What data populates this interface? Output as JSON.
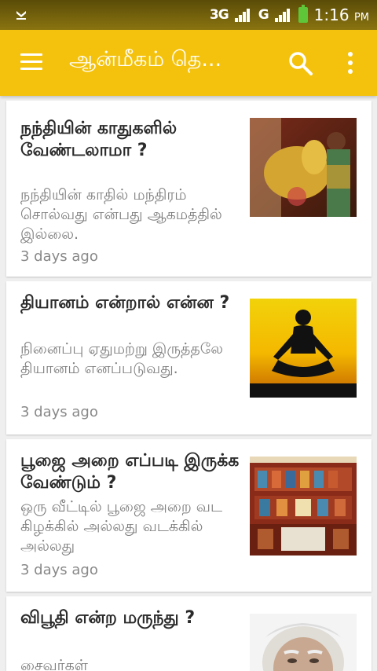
{
  "status_bar": {
    "network_label": "3G",
    "sim2_label": "G",
    "time": "1:16",
    "ampm": "PM"
  },
  "app_bar": {
    "title": "ஆன்மீகம் தெ...",
    "menu_icon": "hamburger-menu-icon",
    "search_icon": "search-icon",
    "overflow_icon": "more-vertical-icon"
  },
  "articles": [
    {
      "title": "நந்தியின் காதுகளில் வேண்டலாமா ?",
      "excerpt": "நந்தியின் காதில் மந்திரம் சொல்வது என்பது ஆகமத்தில் இல்லை.",
      "time": "3 days ago",
      "image": "woman-at-nandi-statue"
    },
    {
      "title": "தியானம் என்றால் என்ன ?",
      "excerpt": "நினைப்பு ஏதுமற்று இருத்தலே தியானம் எனப்படுவது.",
      "time": "3 days ago",
      "image": "meditation-silhouette-sunset"
    },
    {
      "title": "பூஜை அறை எப்படி இருக்க வேண்டும் ?",
      "excerpt": "ஒரு வீட்டில் பூஜை அறை வட கிழக்கில் அல்லது வடக்கில் அல்லது",
      "time": "3 days ago",
      "image": "pooja-room-shelves"
    },
    {
      "title": "விபூதி என்ற மருந்து ?",
      "excerpt": "சைவர்கள்",
      "time": "",
      "image": "elderly-man-face"
    }
  ]
}
